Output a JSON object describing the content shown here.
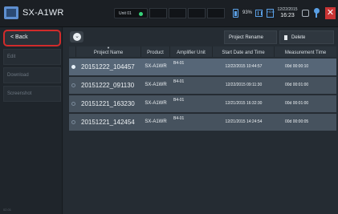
{
  "header": {
    "app_title": "SX-A1WR",
    "unit_label": "Unit 01",
    "battery": "93%",
    "hdd_label": "HDD",
    "clock_date": "12/22/2015",
    "clock_time": "16:23",
    "close_glyph": "✕"
  },
  "sidebar": {
    "back_label": "< Back",
    "items": [
      {
        "label": "Edit"
      },
      {
        "label": "Download"
      },
      {
        "label": "Screenshot"
      }
    ],
    "footer": "02.01"
  },
  "toolbar": {
    "circle_glyph": "⌄",
    "rename_label": "Project Rename",
    "delete_label": "Delete"
  },
  "table": {
    "sort_glyph": "▼",
    "columns": [
      "Project Name",
      "Product",
      "Amplifier Unit",
      "Start Date and Time",
      "Measurement Time"
    ],
    "rows": [
      {
        "name": "20151222_104457",
        "product": "SX-A1WR",
        "amp": "B4-01",
        "start": "12/22/2015 10:44:57",
        "meas": "00d 00:00:10"
      },
      {
        "name": "20151222_091130",
        "product": "SX-A1WR",
        "amp": "B4-01",
        "start": "12/22/2015 09:11:30",
        "meas": "00d 00:01:00"
      },
      {
        "name": "20151221_163230",
        "product": "SX-A1WR",
        "amp": "B4-01",
        "start": "12/21/2015 16:32:30",
        "meas": "00d 00:01:00"
      },
      {
        "name": "20151221_142454",
        "product": "SX-A1WR",
        "amp": "B4-01",
        "start": "12/21/2015 14:24:54",
        "meas": "00d 00:00:05"
      }
    ]
  },
  "colors": {
    "accent_blue": "#5aa0e6",
    "highlight_red": "#d12b2b",
    "close_red": "#c93434",
    "status_green": "#37d37a"
  }
}
